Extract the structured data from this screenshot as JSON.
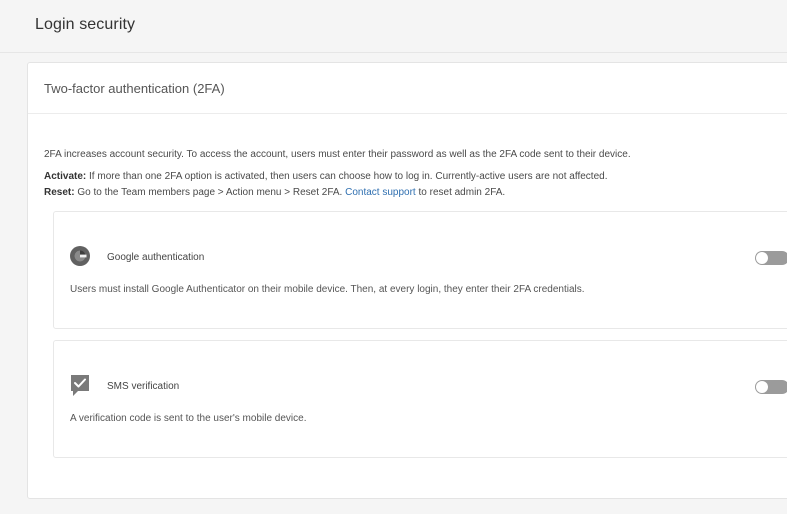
{
  "page": {
    "title": "Login security"
  },
  "card": {
    "title": "Two-factor authentication (2FA)"
  },
  "intro": "2FA increases account security. To access the account, users must enter their password as well as the 2FA code sent to their device.",
  "activate": {
    "label": "Activate:",
    "text": " If more than one 2FA option is activated, then users can choose how to log in. Currently-active users are not affected."
  },
  "reset": {
    "label": "Reset:",
    "text": " Go to the Team members page > Action menu > Reset 2FA. ",
    "link": "Contact support",
    "suffix": " to reset admin 2FA."
  },
  "options": [
    {
      "icon": "google-authenticator-icon",
      "title": "Google authentication",
      "description": "Users must install Google Authenticator on their mobile device. Then, at every login, they enter their 2FA credentials.",
      "enabled": false
    },
    {
      "icon": "sms-check-icon",
      "title": "SMS verification",
      "description": "A verification code is sent to the user's mobile device.",
      "enabled": false
    }
  ],
  "colors": {
    "link": "#2f6fb0",
    "toggle_off": "#9b9b9b"
  }
}
